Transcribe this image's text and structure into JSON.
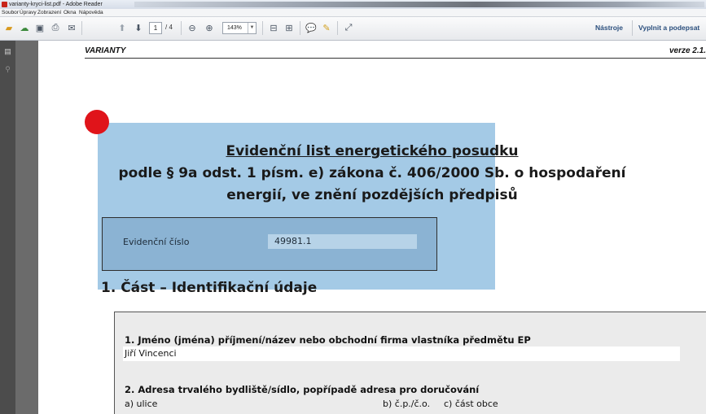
{
  "window": {
    "title": "varianty-kryci-list.pdf - Adobe Reader"
  },
  "menu": [
    "Soubor",
    "Úpravy",
    "Zobrazení",
    "Okna",
    "Nápověda"
  ],
  "toolbar": {
    "page_current": "1",
    "page_total": "/ 4",
    "zoom": "143%",
    "tools_label": "Nástroje",
    "fill_sign_label": "Vyplnit a podepsat"
  },
  "document": {
    "header_left": "VARIANTY",
    "header_right": "verze 2.1.",
    "title_line1": "Evidenční list energetického posudku",
    "title_line2": "podle § 9a odst. 1 písm. e) zákona č. 406/2000 Sb. o hospodaření",
    "title_line3": "energií, ve znění pozdějších předpisů",
    "evid_label": "Evidenční číslo",
    "evid_value": "49981.1",
    "section_title": "1. Část – Identifikační údaje",
    "q1_label": "1. Jméno (jména) příjmení/název nebo obchodní firma vlastníka předmětu EP",
    "q1_value": "Jiří Vincenci",
    "q2_label": "2. Adresa trvalého bydliště/sídlo, popřípadě adresa pro doručování",
    "q2_street": "a) ulice",
    "q2_number": "b) č.p./č.o.",
    "q2_district": "c) část obce"
  },
  "colors": {
    "overlay": "#9cc6e4",
    "marker": "#e0141a",
    "link": "#2b4f7d"
  },
  "icons": [
    "create-icon",
    "cloud-icon",
    "save-icon",
    "print-icon",
    "email-icon",
    "prev-page-icon",
    "next-page-icon",
    "zoom-out-icon",
    "zoom-in-icon",
    "fit-page-icon",
    "fit-width-icon",
    "comment-icon",
    "highlight-icon",
    "fullscreen-icon",
    "pages-panel-icon",
    "attachments-icon"
  ]
}
